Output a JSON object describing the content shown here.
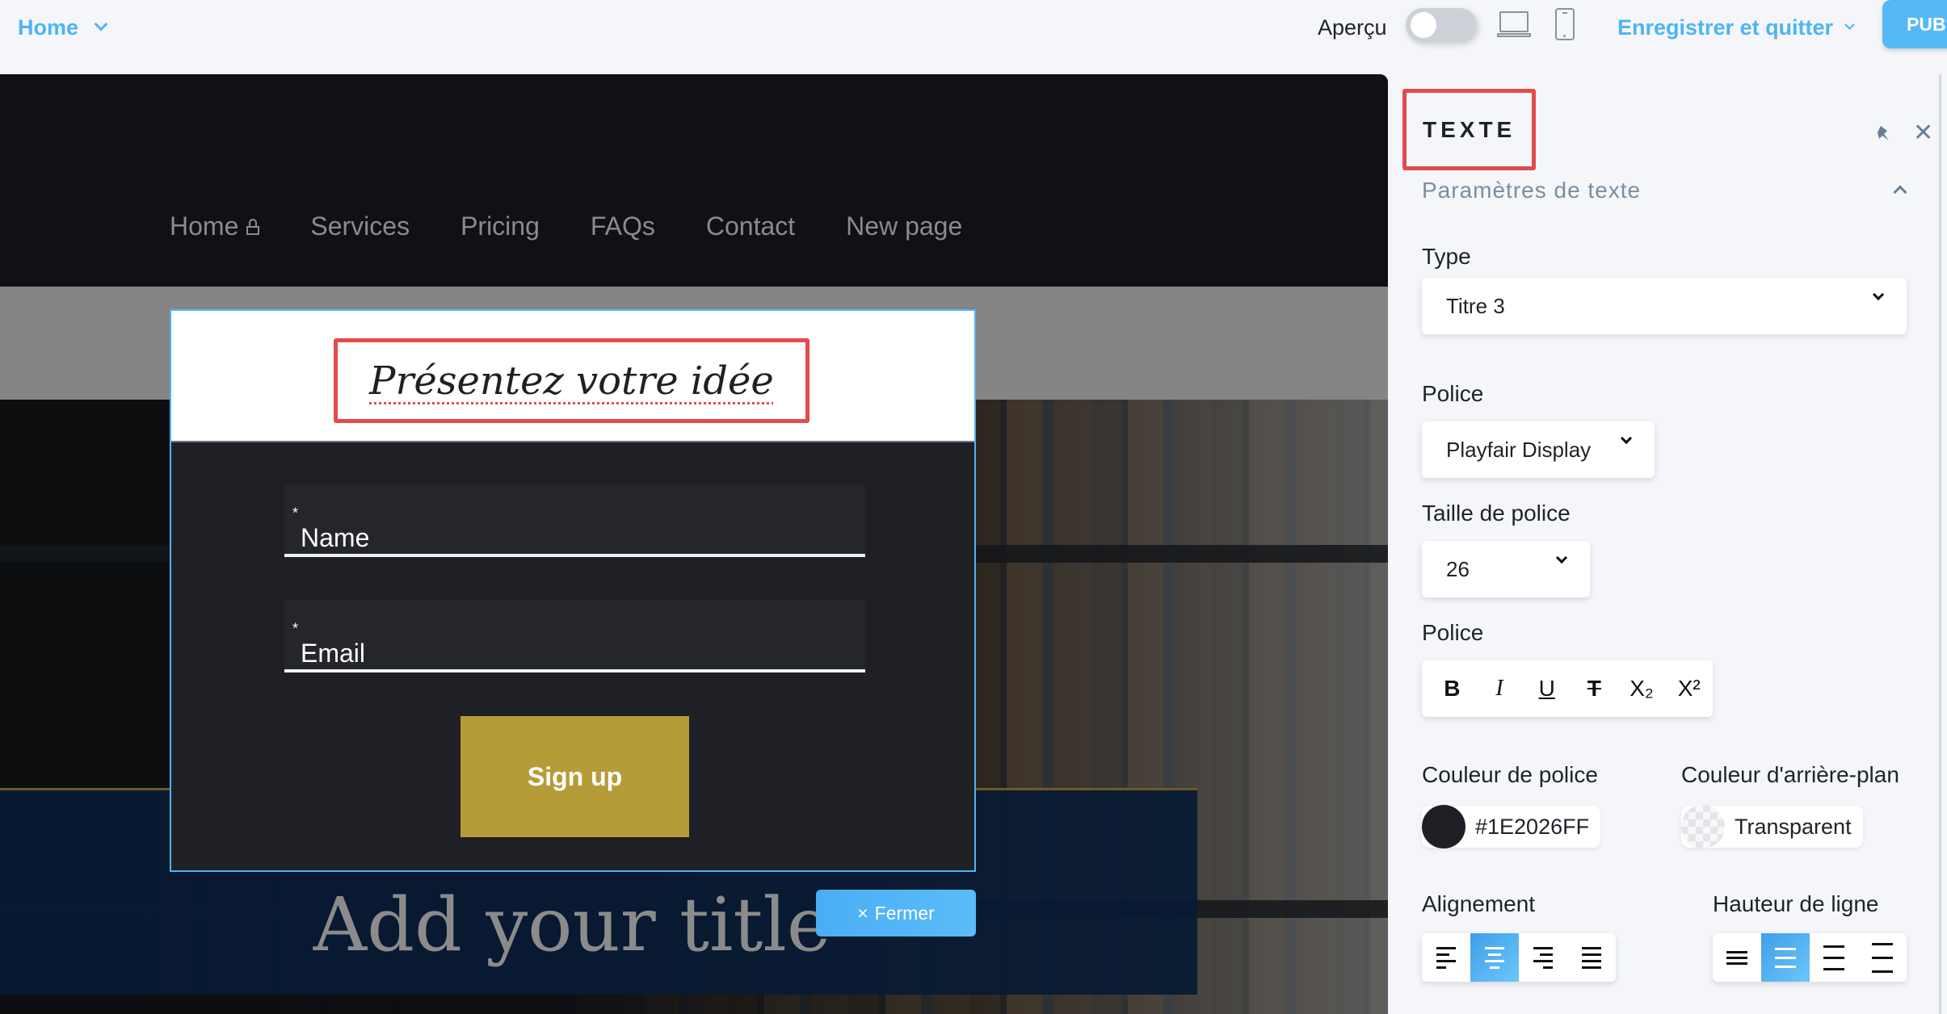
{
  "topbar": {
    "page_select": "Home",
    "preview_label": "Aperçu",
    "preview_on": false,
    "save_quit": "Enregistrer et quitter",
    "publish": "PUB"
  },
  "site": {
    "nav": [
      "Home",
      "Services",
      "Pricing",
      "FAQs",
      "Contact",
      "New page"
    ],
    "hero_title": "Add your title"
  },
  "modal": {
    "title": "Présentez votre idée",
    "name_field": "Name",
    "email_field": "Email",
    "required_mark": "*",
    "signup": "Sign up",
    "close": "Fermer",
    "close_icon": "×"
  },
  "panel": {
    "title": "TEXTE",
    "section": "Paramètres de texte",
    "type_label": "Type",
    "type_value": "Titre 3",
    "font_label": "Police",
    "font_value": "Playfair Display",
    "size_label": "Taille de police",
    "size_value": "26",
    "style_label": "Police",
    "style_buttons": [
      "B",
      "I",
      "U",
      "T",
      "X₂",
      "X²"
    ],
    "font_color_label": "Couleur de police",
    "font_color_value": "#1E2026FF",
    "bg_color_label": "Couleur d'arrière-plan",
    "bg_color_value": "Transparent",
    "align_label": "Alignement",
    "align_active": "center",
    "line_height_label": "Hauteur de ligne",
    "line_height_active": 2
  },
  "colors": {
    "accent": "#4fb4f2",
    "highlight": "#e24b4b",
    "gold": "#b59c38",
    "font_color": "#1e2026"
  }
}
